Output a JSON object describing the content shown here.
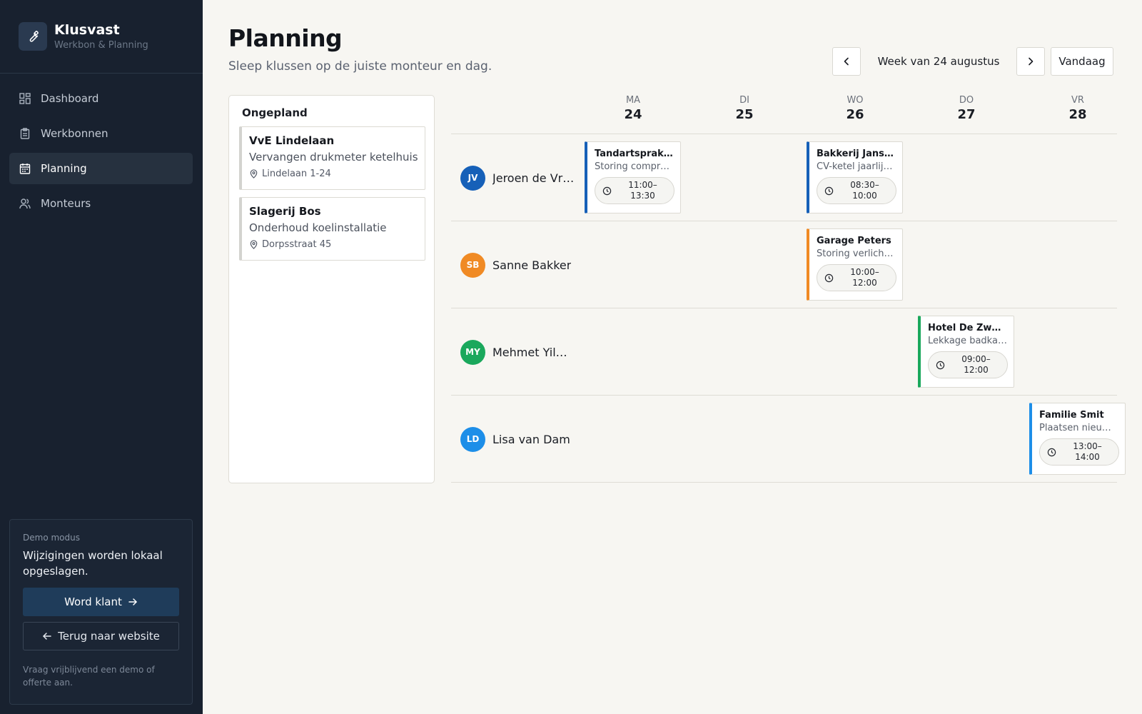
{
  "sidebar": {
    "brand_name": "Klusvast",
    "brand_sub": "Werkbon & Planning",
    "nav": [
      {
        "label": "Dashboard",
        "icon": "dashboard-icon"
      },
      {
        "label": "Werkbonnen",
        "icon": "clipboard-icon"
      },
      {
        "label": "Planning",
        "icon": "calendar-icon",
        "active": true
      },
      {
        "label": "Monteurs",
        "icon": "users-icon"
      }
    ],
    "demo": {
      "label": "Demo modus",
      "text": "Wijzigingen worden lokaal opgeslagen.",
      "primary_button": "Word klant",
      "secondary_button": "Terug naar website",
      "footer": "Vraag vrijblijvend een demo of offerte aan."
    }
  },
  "header": {
    "title": "Planning",
    "subtitle": "Sleep klussen op de juiste monteur en dag.",
    "week_label": "Week van 24 augustus",
    "today_button": "Vandaag"
  },
  "unplanned": {
    "title": "Ongepland",
    "jobs": [
      {
        "name": "VvE Lindelaan",
        "desc": "Vervangen drukmeter ketelhuis",
        "location": "Lindelaan 1-24"
      },
      {
        "name": "Slagerij Bos",
        "desc": "Onderhoud koelinstallatie",
        "location": "Dorpsstraat 45"
      }
    ]
  },
  "days": [
    {
      "abbr": "MA",
      "num": "24"
    },
    {
      "abbr": "DI",
      "num": "25"
    },
    {
      "abbr": "WO",
      "num": "26"
    },
    {
      "abbr": "DO",
      "num": "27"
    },
    {
      "abbr": "VR",
      "num": "28"
    }
  ],
  "technicians": [
    {
      "initials": "JV",
      "name": "Jeroen de Vri...",
      "color": "#1660b8"
    },
    {
      "initials": "SB",
      "name": "Sanne Bakker",
      "color": "#f08a24"
    },
    {
      "initials": "MY",
      "name": "Mehmet Yilm...",
      "color": "#1aa85c"
    },
    {
      "initials": "LD",
      "name": "Lisa van Dam",
      "color": "#1d8ee8"
    }
  ],
  "appointments": [
    {
      "tech": 0,
      "day": 0,
      "name": "Tandartspraktij...",
      "desc": "Storing compres...",
      "start": "11:00–",
      "end": "13:30",
      "color": "#1660b8"
    },
    {
      "tech": 0,
      "day": 2,
      "name": "Bakkerij Janssen",
      "desc": "CV-ketel jaarlijks...",
      "start": "08:30–",
      "end": "10:00",
      "color": "#1660b8"
    },
    {
      "tech": 1,
      "day": 2,
      "name": "Garage Peters",
      "desc": "Storing verlichtin...",
      "start": "10:00–",
      "end": "12:00",
      "color": "#f08a24"
    },
    {
      "tech": 2,
      "day": 3,
      "name": "Hotel De Zwaan",
      "desc": "Lekkage badkam...",
      "start": "09:00–",
      "end": "12:00",
      "color": "#1aa85c"
    },
    {
      "tech": 3,
      "day": 4,
      "name": "Familie Smit",
      "desc": "Plaatsen nieuwe...",
      "start": "13:00–",
      "end": "14:00",
      "color": "#1d8ee8"
    }
  ]
}
